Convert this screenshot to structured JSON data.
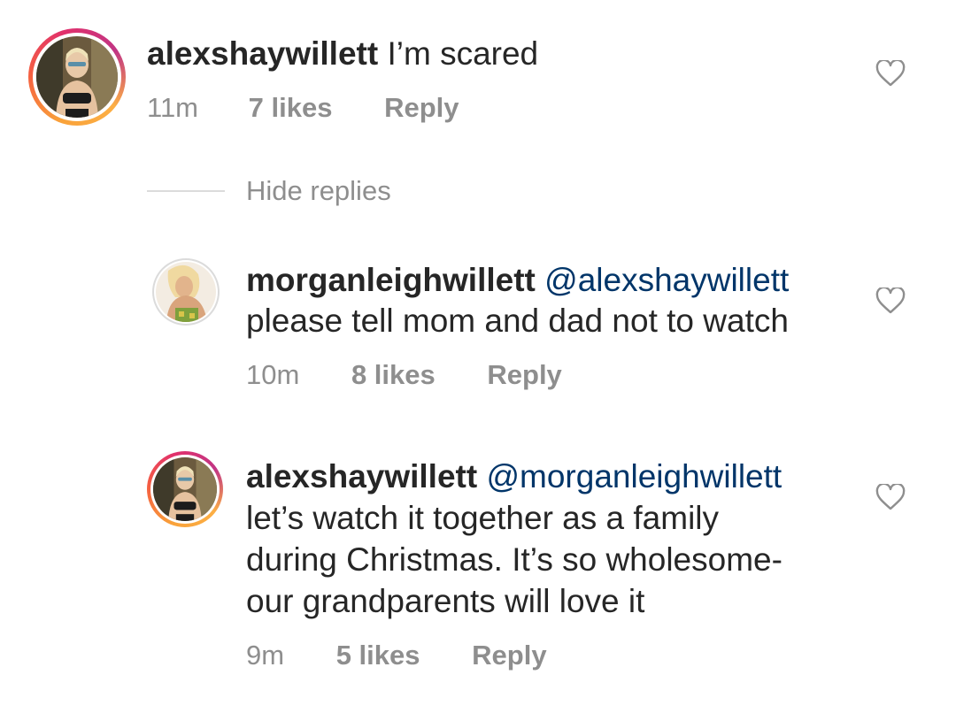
{
  "comment": {
    "username": "alexshaywillett",
    "text": "I’m scared",
    "time": "11m",
    "likes": "7 likes",
    "reply": "Reply"
  },
  "hide_replies": "Hide replies",
  "replies": [
    {
      "username": "morganleighwillett",
      "mention": "@alexshaywillett",
      "lines": [
        "please tell mom and dad not to watch"
      ],
      "time": "10m",
      "likes": "8 likes",
      "reply": "Reply"
    },
    {
      "username": "alexshaywillett",
      "mention": "@morganleighwillett",
      "lines": [
        "let’s watch it together as a family",
        "during Christmas. It’s so wholesome-",
        "our grandparents will love it"
      ],
      "time": "9m",
      "likes": "5 likes",
      "reply": "Reply"
    }
  ],
  "icons": {
    "like": "heart-outline-icon"
  },
  "colors": {
    "username": "#262626",
    "mention": "#003569",
    "meta": "#8e8e8e",
    "divider": "#dbdbdb"
  }
}
